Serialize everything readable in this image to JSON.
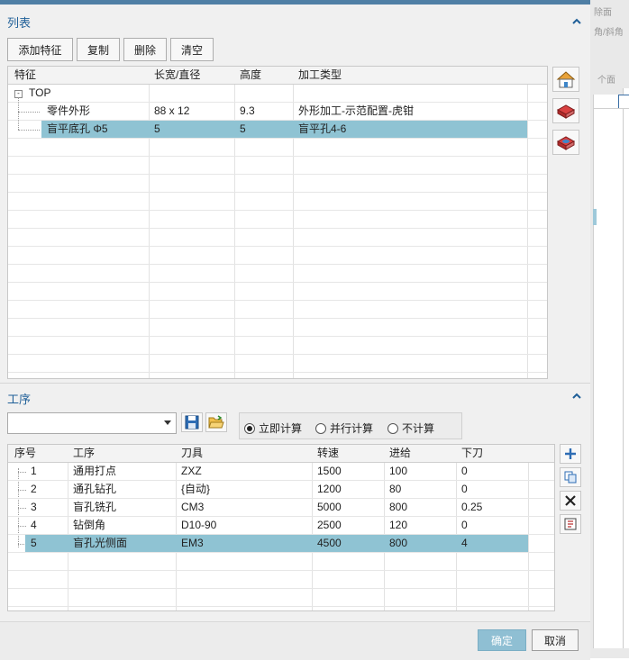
{
  "list_section": {
    "title": "列表",
    "buttons": [
      "添加特征",
      "复制",
      "删除",
      "清空"
    ],
    "columns": [
      "特征",
      "长宽/直径",
      "高度",
      "加工类型"
    ],
    "rows": [
      {
        "feature": "TOP",
        "size": "",
        "height": "",
        "type": ""
      },
      {
        "feature": "零件外形",
        "size": "88 x 12",
        "height": "9.3",
        "type": "外形加工-示范配置-虎钳"
      },
      {
        "feature": "盲平底孔 Φ5",
        "size": "5",
        "height": "5",
        "type": "盲平孔4-6"
      }
    ],
    "side_icons": [
      "house-feature-icon",
      "block-feature-icon",
      "pocket-feature-icon"
    ]
  },
  "process_section": {
    "title": "工序",
    "dropdown_value": "",
    "radio_options": [
      "立即计算",
      "并行计算",
      "不计算"
    ],
    "radio_selected": "立即计算",
    "columns": [
      "序号",
      "工序",
      "刀具",
      "转速",
      "进给",
      "下刀"
    ],
    "rows": [
      {
        "no": "1",
        "op": "通用打点",
        "tool": "ZXZ",
        "speed": "1500",
        "feed": "100",
        "plunge": "0"
      },
      {
        "no": "2",
        "op": "通孔钻孔",
        "tool": "{自动}",
        "speed": "1200",
        "feed": "80",
        "plunge": "0"
      },
      {
        "no": "3",
        "op": "盲孔铣孔",
        "tool": "CM3",
        "speed": "5000",
        "feed": "800",
        "plunge": "0.25"
      },
      {
        "no": "4",
        "op": "钻倒角",
        "tool": "D10-90",
        "speed": "2500",
        "feed": "120",
        "plunge": "0"
      },
      {
        "no": "5",
        "op": "盲孔光侧面",
        "tool": "EM3",
        "speed": "4500",
        "feed": "800",
        "plunge": "4"
      }
    ],
    "side_icons": [
      "add-icon",
      "copy-icon",
      "delete-icon",
      "export-icon"
    ]
  },
  "footer": {
    "ok": "确定",
    "cancel": "取消"
  },
  "background": {
    "text1": "除面",
    "text2": "角/斜角",
    "text3": "个面"
  },
  "colors": {
    "accent": "#1f5f98",
    "selection": "#8fc3d3",
    "ok_button": "#8fbfd3"
  }
}
